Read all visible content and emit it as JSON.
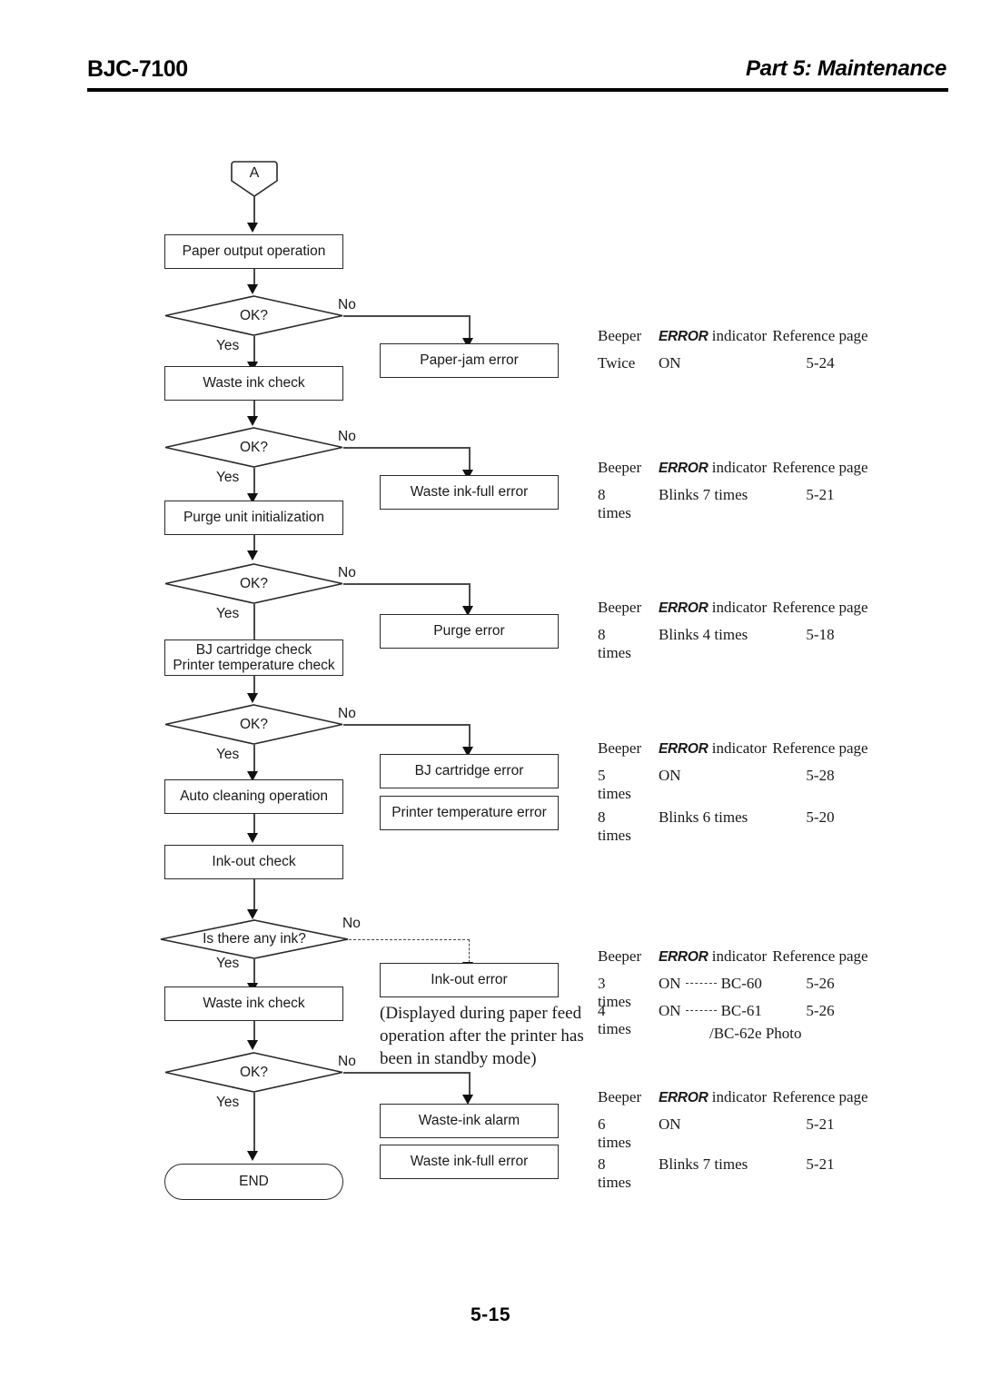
{
  "header": {
    "model": "BJC-7100",
    "part": "Part 5: Maintenance"
  },
  "footer": {
    "page": "5-15"
  },
  "flow": {
    "connector_a": "A",
    "yes_label": "Yes",
    "no_label": "No",
    "nodes": {
      "paper_output": "Paper output operation",
      "ok_1": "OK?",
      "waste_ink_check_1": "Waste ink check",
      "ok_2": "OK?",
      "purge_init": "Purge unit initialization",
      "ok_3": "OK?",
      "bj_cartridge_check": "BJ cartridge check",
      "printer_temp_check": "Printer temperature check",
      "ok_4": "OK?",
      "auto_cleaning": "Auto cleaning operation",
      "ink_out_check": "Ink-out check",
      "is_there_any_ink": "Is there any ink?",
      "waste_ink_check_2": "Waste ink check",
      "ok_5": "OK?",
      "end": "END"
    },
    "errors": {
      "paper_jam": "Paper-jam error",
      "waste_ink_full_1": "Waste ink-full error",
      "purge": "Purge error",
      "bj_cartridge": "BJ cartridge error",
      "printer_temp": "Printer temperature error",
      "ink_out": "Ink-out error",
      "waste_ink_alarm": "Waste-ink alarm",
      "waste_ink_full_2": "Waste ink-full error"
    },
    "note": "(Displayed during paper feed operation after the printer has been in standby mode)"
  },
  "table_headers": {
    "beeper": "Beeper",
    "indicator_prefix": "ERROR",
    "indicator_suffix": " indicator",
    "reference": "Reference page"
  },
  "tables": [
    {
      "id": "paper-jam",
      "rows": [
        {
          "beeper": "Twice",
          "indicator": "ON",
          "reference": "5-24"
        }
      ]
    },
    {
      "id": "waste-ink-full-1",
      "rows": [
        {
          "beeper": "8 times",
          "indicator": "Blinks 7 times",
          "reference": "5-21"
        }
      ]
    },
    {
      "id": "purge",
      "rows": [
        {
          "beeper": "8 times",
          "indicator": "Blinks 4 times",
          "reference": "5-18"
        }
      ]
    },
    {
      "id": "bj-cartridge-temp",
      "rows": [
        {
          "beeper": "5 times",
          "indicator": "ON",
          "reference": "5-28"
        },
        {
          "beeper": "8 times",
          "indicator": "Blinks 6 times",
          "reference": "5-20"
        }
      ]
    },
    {
      "id": "ink-out",
      "rows": [
        {
          "beeper": "3 times",
          "indicator": "ON",
          "link": "BC-60",
          "reference": "5-26"
        },
        {
          "beeper": "4 times",
          "indicator": "ON",
          "link": "BC-61",
          "link2": "/BC-62e Photo",
          "reference": "5-26"
        }
      ]
    },
    {
      "id": "waste-ink-alarm",
      "rows": [
        {
          "beeper": "6 times",
          "indicator": "ON",
          "reference": "5-21"
        },
        {
          "beeper": "8 times",
          "indicator": "Blinks 7 times",
          "reference": "5-21"
        }
      ]
    }
  ]
}
